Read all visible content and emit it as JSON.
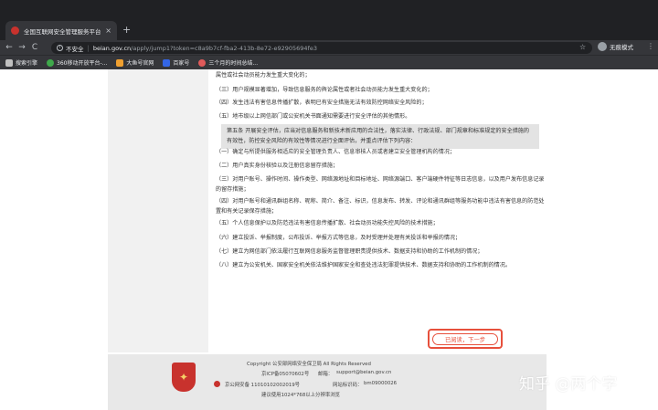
{
  "browser": {
    "tab_title": "全国互联网安全管理服务平台",
    "tab_close": "×",
    "new_tab": "+",
    "nav": {
      "back": "←",
      "forward": "→",
      "reload": "C"
    },
    "security_label": "不安全",
    "separator": "|",
    "url_host": "beian.gov.cn",
    "url_path": "/apply/jump1?token=c8a9b7cf-fba2-413b-8e72-e92905694fe3",
    "star": "☆",
    "profile_label": "无痕模式",
    "menu": "⋮",
    "bookmarks": [
      {
        "label": "搜索引擎",
        "color": "#c0c0c0"
      },
      {
        "label": "360移动开放平台-...",
        "color": "#3fa94b"
      },
      {
        "label": "大鱼号官网",
        "color": "#f0a030"
      },
      {
        "label": "百家号",
        "color": "#3366e6"
      },
      {
        "label": "三个月的时间总结...",
        "color": "#e05a5a"
      }
    ]
  },
  "page": {
    "paragraphs": [
      "属性或社会动员能力发生重大变化的；",
      "（三）用户规模显著增加，导致信息服务的舆论属性或者社会动员能力发生重大变化的；",
      "（四）发生违法有害信息传播扩散，表明已有安全措施无法有效防控网络安全风险的；",
      "（五）地市级以上网信部门或公安机关书面通知需要进行安全评估的其他情形。",
      "第五条 开展安全评估，应当对信息服务和新技术新应用的合法性，落实法律、行政法规、部门规章和标准规定的安全措施的有效性，防控安全风险的有效性等情况进行全面评估，并重点评估下列内容：",
      "（一）确定与所提供服务相适应的安全管理负责人、信息审核人员或者建立安全管理机构的情况；",
      "（二）用户真实身份核验以及注册信息留存措施；",
      "（三）对用户账号、操作时间、操作类型、网络源地址和目标地址、网络源端口、客户端硬件特征等日志信息，以及用户发布信息记录的留存措施；",
      "（四）对用户账号和通讯群组名称、昵称、简介、备注、标识，信息发布、转发、评论和通讯群组等服务功能中违法有害信息的防范处置和有关记录保存措施；",
      "（五）个人信息保护以及防范违法有害信息传播扩散、社会动员功能失控风险的技术措施；",
      "（六）建立投诉、举报制度，公布投诉、举报方式等信息，及时受理并处理有关投诉和举报的情况；",
      "（七）建立为网信部门依法履行互联网信息服务监督管理职责提供技术、数据支持和协助的工作机制的情况；",
      "（八）建立为公安机关、国家安全机关依法维护国家安全和查处违法犯罪提供技术、数据支持和协助的工作机制的情况。"
    ],
    "read_button": "已阅读，下一步",
    "footer": {
      "copyright": "Copyright 公安部网络安全保卫局 All Rights Reserved",
      "icp_prefix": "京ICP备05070602号",
      "email_label": "邮箱：",
      "email": "support@beian.gov.cn",
      "gongan": "京公网安备 11010102002019号",
      "site_code_label": "网站标识码：",
      "site_code": "bm09000026",
      "resolution": "建议使用1024*768以上分辨率浏览"
    },
    "watermark": "知乎 @两个字"
  }
}
